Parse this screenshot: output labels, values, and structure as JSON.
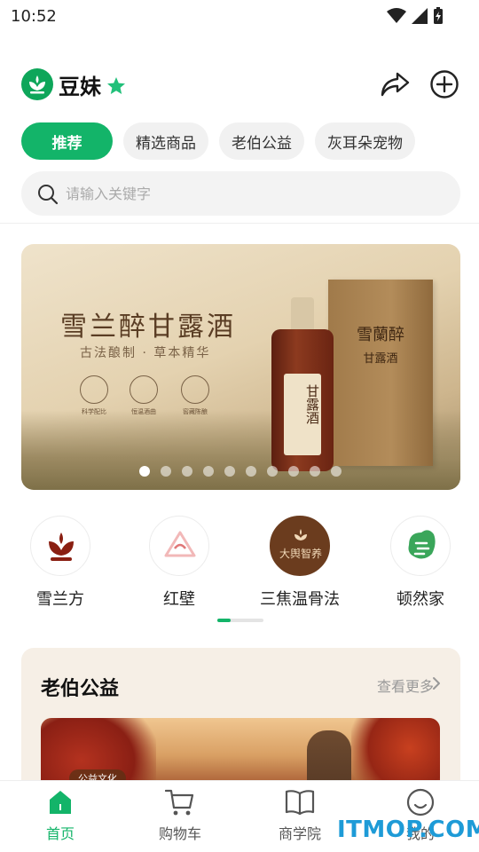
{
  "status_bar": {
    "time": "10:52"
  },
  "header": {
    "app_name": "豆妹"
  },
  "tabs": [
    {
      "label": "推荐",
      "active": true
    },
    {
      "label": "精选商品",
      "active": false
    },
    {
      "label": "老伯公益",
      "active": false
    },
    {
      "label": "灰耳朵宠物",
      "active": false
    }
  ],
  "search": {
    "placeholder": "请输入关键字"
  },
  "banner": {
    "title": "雪兰醉甘露酒",
    "subtitle": "古法酿制 · 草本精华",
    "features": [
      "科学配比",
      "恒温酒曲",
      "窖藏陈酿"
    ],
    "bottle_text": "甘露酒",
    "box_text_1": "雪蘭醉",
    "box_text_2": "甘露酒",
    "dot_count": 10,
    "active_dot": 0
  },
  "brands": [
    {
      "name": "雪兰方",
      "icon": "lotus-icon"
    },
    {
      "name": "红壁",
      "icon": "red-wall-logo-icon"
    },
    {
      "name": "三焦温骨法",
      "icon": "sanjiao-logo-icon",
      "logo_text": "大舆智养"
    },
    {
      "name": "顿然家",
      "icon": "dunran-logo-icon"
    }
  ],
  "charity": {
    "title": "老伯公益",
    "more_label": "查看更多",
    "badge": "公益文化"
  },
  "bottom_nav": [
    {
      "label": "首页",
      "icon": "home-icon",
      "active": true
    },
    {
      "label": "购物车",
      "icon": "cart-icon",
      "active": false
    },
    {
      "label": "商学院",
      "icon": "book-icon",
      "active": false
    },
    {
      "label": "我的",
      "icon": "profile-icon",
      "active": false
    }
  ],
  "watermark": "ITMOP.COM",
  "colors": {
    "accent": "#13b469",
    "banner_text": "#5a3d24",
    "charity_bg": "#f6efe6"
  }
}
